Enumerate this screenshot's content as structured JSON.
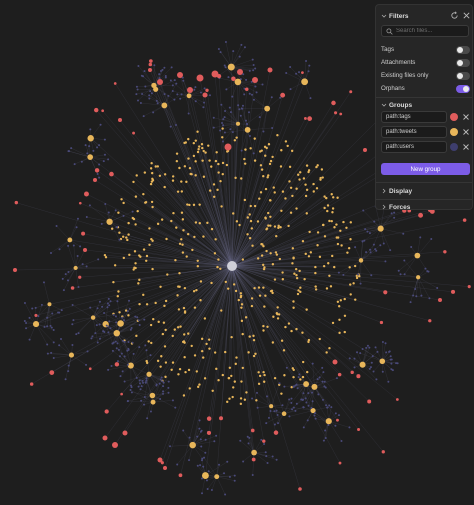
{
  "graph": {
    "background": "#1e1e1e",
    "edge_color": "#6b6b8a",
    "node_colors": {
      "tags": "#e05c5c",
      "tweets": "#e8b65a",
      "users": "#4a4a7a",
      "selected": "#cfcfd8"
    }
  },
  "panel": {
    "filters": {
      "title": "Filters",
      "search_placeholder": "Search files...",
      "options": [
        {
          "label": "Tags",
          "enabled": false
        },
        {
          "label": "Attachments",
          "enabled": false
        },
        {
          "label": "Existing files only",
          "enabled": false
        },
        {
          "label": "Orphans",
          "enabled": true
        }
      ]
    },
    "groups": {
      "title": "Groups",
      "items": [
        {
          "query": "path:tags",
          "color": "#e05c5c"
        },
        {
          "query": "path:tweets",
          "color": "#e8b65a"
        },
        {
          "query": "path:users",
          "color": "#3e3e6e"
        }
      ],
      "new_group_label": "New group"
    },
    "display": {
      "title": "Display"
    },
    "forces": {
      "title": "Forces"
    }
  }
}
